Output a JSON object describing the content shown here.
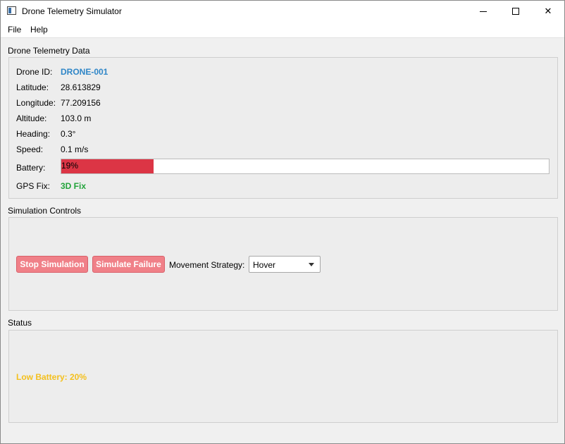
{
  "window": {
    "title": "Drone Telemetry Simulator",
    "controls": {
      "minimize": "minimize-icon",
      "maximize": "maximize-icon",
      "close": "✕"
    }
  },
  "menu": {
    "file": "File",
    "help": "Help"
  },
  "telemetry": {
    "title": "Drone Telemetry Data",
    "drone_id_label": "Drone ID:",
    "drone_id": "DRONE-001",
    "latitude_label": "Latitude:",
    "latitude": "28.613829",
    "longitude_label": "Longitude:",
    "longitude": "77.209156",
    "altitude_label": "Altitude:",
    "altitude": "103.0 m",
    "heading_label": "Heading:",
    "heading": "0.3°",
    "speed_label": "Speed:",
    "speed": "0.1 m/s",
    "battery_label": "Battery:",
    "battery_text": "19%",
    "battery_level": 0.19,
    "battery_color": "#dc3545",
    "gps_label": "GPS Fix:",
    "gps_fix": "3D Fix"
  },
  "controls": {
    "title": "Simulation Controls",
    "stop_label": "Stop Simulation",
    "failure_label": "Simulate Failure",
    "strategy_label": "Movement Strategy:",
    "strategy_value": "Hover"
  },
  "status": {
    "title": "Status",
    "message": "Low Battery: 20%"
  },
  "colors": {
    "drone_id": "#2f86c7",
    "gps_fix": "#22a33a",
    "button_bg": "#f08088",
    "status_warning": "#f4c01e"
  }
}
